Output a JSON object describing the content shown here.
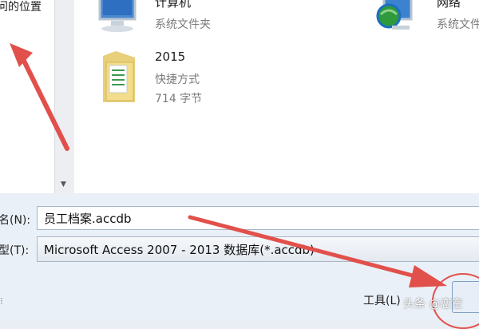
{
  "left_pane": {
    "location_label": "问的位置"
  },
  "main_pane": {
    "items": [
      {
        "name": "计算机",
        "type": "系统文件夹",
        "icon": "computer-icon"
      },
      {
        "name": "网络",
        "type": "系统文件夹",
        "icon": "network-icon"
      },
      {
        "name": "2015",
        "type": "快捷方式",
        "size": "714 字节",
        "icon": "folder-shortcut-icon"
      }
    ]
  },
  "form": {
    "filename_label": "名(N):",
    "filename_value": "员工档案.accdb",
    "filetype_label": "型(T):",
    "filetype_value": "Microsoft Access 2007 - 2013 数据库(*.accdb)"
  },
  "footer": {
    "tools_label": "工具(L)",
    "watermark": "头条 @恋空"
  },
  "colors": {
    "annotation_red": "#e2504c"
  }
}
